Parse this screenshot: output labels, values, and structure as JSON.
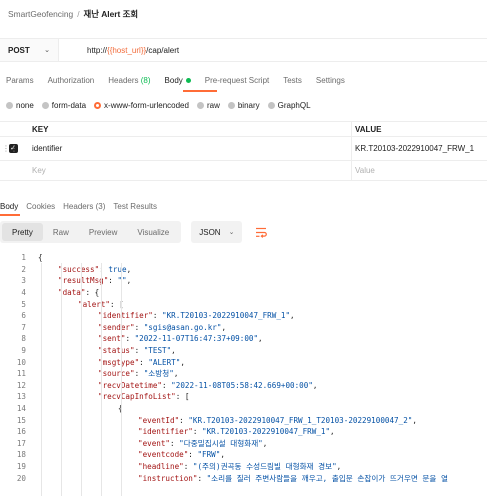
{
  "breadcrumb": {
    "collection": "SmartGeofencing",
    "separator": "/",
    "current": "재난 Alert 조회"
  },
  "request": {
    "method": "POST",
    "url_prefix": "http://",
    "url_variable": "{{host_url}}",
    "url_suffix": "/cap/alert"
  },
  "request_tabs": [
    "Params",
    "Authorization",
    "Headers",
    "Body",
    "Pre-request Script",
    "Tests",
    "Settings"
  ],
  "headers_count": "(8)",
  "body_types": [
    "none",
    "form-data",
    "x-www-form-urlencoded",
    "raw",
    "binary",
    "GraphQL"
  ],
  "params_table": {
    "key_header": "KEY",
    "value_header": "VALUE",
    "row_key": "identifier",
    "row_value": "KR.T20103-2022910047_FRW_1",
    "key_placeholder": "Key",
    "value_placeholder": "Value"
  },
  "response_tabs": [
    "Body",
    "Cookies",
    "Headers",
    "Test Results"
  ],
  "response_headers_count": "(3)",
  "view_modes": [
    "Pretty",
    "Raw",
    "Preview",
    "Visualize"
  ],
  "format": "JSON",
  "code_lines": [
    {
      "n": "1",
      "indent": 0,
      "parts": [
        {
          "t": "{",
          "c": "txt"
        }
      ]
    },
    {
      "n": "2",
      "indent": 1,
      "parts": [
        {
          "t": "\"success\"",
          "c": "k"
        },
        {
          "t": ": ",
          "c": "txt"
        },
        {
          "t": "true",
          "c": "b"
        },
        {
          "t": ",",
          "c": "txt"
        }
      ]
    },
    {
      "n": "3",
      "indent": 1,
      "parts": [
        {
          "t": "\"resultMsg\"",
          "c": "k"
        },
        {
          "t": ": ",
          "c": "txt"
        },
        {
          "t": "\"\"",
          "c": "s"
        },
        {
          "t": ",",
          "c": "txt"
        }
      ]
    },
    {
      "n": "4",
      "indent": 1,
      "parts": [
        {
          "t": "\"data\"",
          "c": "k"
        },
        {
          "t": ": {",
          "c": "txt"
        }
      ]
    },
    {
      "n": "5",
      "indent": 2,
      "parts": [
        {
          "t": "\"alert\"",
          "c": "k"
        },
        {
          "t": ": [",
          "c": "txt"
        }
      ]
    },
    {
      "n": "6",
      "indent": 3,
      "parts": [
        {
          "t": "\"identifier\"",
          "c": "k"
        },
        {
          "t": ": ",
          "c": "txt"
        },
        {
          "t": "\"KR.T20103-2022910047_FRW_1\"",
          "c": "s"
        },
        {
          "t": ",",
          "c": "txt"
        }
      ]
    },
    {
      "n": "7",
      "indent": 3,
      "parts": [
        {
          "t": "\"sender\"",
          "c": "k"
        },
        {
          "t": ": ",
          "c": "txt"
        },
        {
          "t": "\"sgis@asan.go.kr\"",
          "c": "s"
        },
        {
          "t": ",",
          "c": "txt"
        }
      ]
    },
    {
      "n": "8",
      "indent": 3,
      "parts": [
        {
          "t": "\"sent\"",
          "c": "k"
        },
        {
          "t": ": ",
          "c": "txt"
        },
        {
          "t": "\"2022-11-07T16:47:37+09:00\"",
          "c": "s"
        },
        {
          "t": ",",
          "c": "txt"
        }
      ]
    },
    {
      "n": "9",
      "indent": 3,
      "parts": [
        {
          "t": "\"status\"",
          "c": "k"
        },
        {
          "t": ": ",
          "c": "txt"
        },
        {
          "t": "\"TEST\"",
          "c": "s"
        },
        {
          "t": ",",
          "c": "txt"
        }
      ]
    },
    {
      "n": "10",
      "indent": 3,
      "parts": [
        {
          "t": "\"msgtype\"",
          "c": "k"
        },
        {
          "t": ": ",
          "c": "txt"
        },
        {
          "t": "\"ALERT\"",
          "c": "s"
        },
        {
          "t": ",",
          "c": "txt"
        }
      ]
    },
    {
      "n": "11",
      "indent": 3,
      "parts": [
        {
          "t": "\"source\"",
          "c": "k"
        },
        {
          "t": ": ",
          "c": "txt"
        },
        {
          "t": "\"소방청\"",
          "c": "s"
        },
        {
          "t": ",",
          "c": "txt"
        }
      ]
    },
    {
      "n": "12",
      "indent": 3,
      "parts": [
        {
          "t": "\"recvDatetime\"",
          "c": "k"
        },
        {
          "t": ": ",
          "c": "txt"
        },
        {
          "t": "\"2022-11-08T05:58:42.669+00:00\"",
          "c": "s"
        },
        {
          "t": ",",
          "c": "txt"
        }
      ]
    },
    {
      "n": "13",
      "indent": 3,
      "parts": [
        {
          "t": "\"recvCapInfoList\"",
          "c": "k"
        },
        {
          "t": ": [",
          "c": "txt"
        }
      ]
    },
    {
      "n": "14",
      "indent": 4,
      "parts": [
        {
          "t": "{",
          "c": "txt"
        }
      ]
    },
    {
      "n": "15",
      "indent": 5,
      "parts": [
        {
          "t": "\"eventId\"",
          "c": "k"
        },
        {
          "t": ": ",
          "c": "txt"
        },
        {
          "t": "\"KR.T20103-2022910047_FRW_1_T20103-20229100047_2\"",
          "c": "s"
        },
        {
          "t": ",",
          "c": "txt"
        }
      ]
    },
    {
      "n": "16",
      "indent": 5,
      "parts": [
        {
          "t": "\"identifier\"",
          "c": "k"
        },
        {
          "t": ": ",
          "c": "txt"
        },
        {
          "t": "\"KR.T20103-2022910047_FRW_1\"",
          "c": "s"
        },
        {
          "t": ",",
          "c": "txt"
        }
      ]
    },
    {
      "n": "17",
      "indent": 5,
      "parts": [
        {
          "t": "\"event\"",
          "c": "k"
        },
        {
          "t": ": ",
          "c": "txt"
        },
        {
          "t": "\"다중밀집시설 대형화재\"",
          "c": "s"
        },
        {
          "t": ",",
          "c": "txt"
        }
      ]
    },
    {
      "n": "18",
      "indent": 5,
      "parts": [
        {
          "t": "\"eventcode\"",
          "c": "k"
        },
        {
          "t": ": ",
          "c": "txt"
        },
        {
          "t": "\"FRW\"",
          "c": "s"
        },
        {
          "t": ",",
          "c": "txt"
        }
      ]
    },
    {
      "n": "19",
      "indent": 5,
      "parts": [
        {
          "t": "\"headline\"",
          "c": "k"
        },
        {
          "t": ": ",
          "c": "txt"
        },
        {
          "t": "\"(주의)권곡동 수성드림빌 대형화재 경보\"",
          "c": "s"
        },
        {
          "t": ",",
          "c": "txt"
        }
      ]
    },
    {
      "n": "20",
      "indent": 5,
      "parts": [
        {
          "t": "\"instruction\"",
          "c": "k"
        },
        {
          "t": ": ",
          "c": "txt"
        },
        {
          "t": "\"소리를 질러 주변사람들을 깨우고, 출입문 손잡이가 뜨거우면 문을 열",
          "c": "s"
        }
      ]
    }
  ],
  "colors": {
    "accent": "#ff6c37",
    "green": "#0cbb52",
    "url_variable": "#f26b3a",
    "json_key": "#a31515",
    "json_string": "#0451a5"
  }
}
